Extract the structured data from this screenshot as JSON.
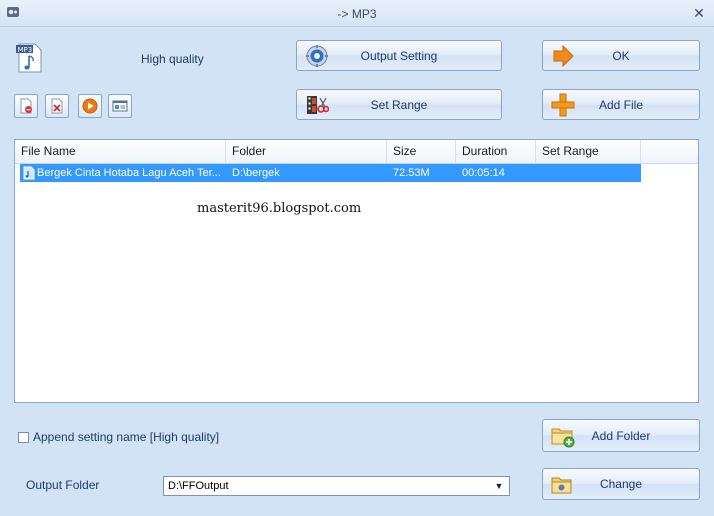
{
  "window": {
    "title": "-> MP3",
    "close_symbol": "✕"
  },
  "header": {
    "quality_label": "High quality"
  },
  "buttons": {
    "output_setting": "Output Setting",
    "ok": "OK",
    "set_range": "Set Range",
    "add_file": "Add File",
    "add_folder": "Add Folder",
    "change": "Change"
  },
  "list": {
    "columns": [
      "File Name",
      "Folder",
      "Size",
      "Duration",
      "Set Range"
    ],
    "rows": [
      {
        "file_name": "Bergek Cinta Hotaba Lagu Aceh Ter...",
        "folder": "D:\\bergek",
        "size": "72.53M",
        "duration": "00:05:14",
        "set_range": ""
      }
    ]
  },
  "watermark": "masterit96.blogspot.com",
  "options": {
    "append_label": "Append setting name [High quality]",
    "append_checked": false
  },
  "output": {
    "label": "Output Folder",
    "value": "D:\\FFOutput"
  },
  "colors": {
    "selection": "#3399ff",
    "background": "#d3e3f6",
    "ok_arrow": "#f08a1c",
    "add_plus": "#f39a1d"
  }
}
